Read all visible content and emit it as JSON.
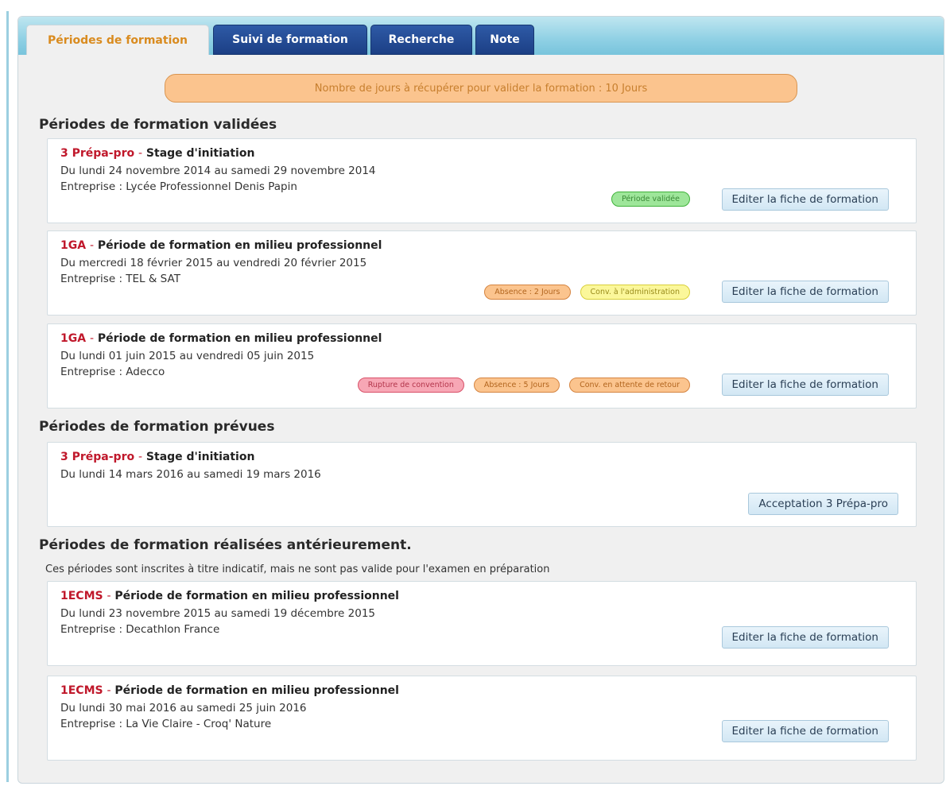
{
  "tabs": [
    {
      "label": "Périodes de formation",
      "active": true
    },
    {
      "label": "Suivi de formation",
      "active": false
    },
    {
      "label": "Recherche",
      "active": false
    },
    {
      "label": "Note",
      "active": false
    }
  ],
  "banner": "Nombre de jours à récupérer pour valider la formation : 10 Jours",
  "sections": {
    "validated": {
      "title": "Périodes de formation validées",
      "cards": [
        {
          "code": "3 Prépa-pro",
          "separator": "-",
          "title": "Stage d'initiation",
          "dates": "Du lundi 24 novembre 2014 au samedi 29 novembre 2014",
          "company": "Entreprise : Lycée Professionnel Denis Papin",
          "badges": [
            {
              "label": "Période validée",
              "color": "green"
            }
          ],
          "button": "Editer la fiche de formation"
        },
        {
          "code": "1GA",
          "separator": "-",
          "title": "Période de formation en milieu professionnel",
          "dates": "Du mercredi 18 février 2015 au vendredi 20 février 2015",
          "company": "Entreprise : TEL & SAT",
          "badges": [
            {
              "label": "Absence : 2 Jours",
              "color": "orange"
            },
            {
              "label": "Conv. à l'administration",
              "color": "yellow"
            }
          ],
          "button": "Editer la fiche de formation"
        },
        {
          "code": "1GA",
          "separator": "-",
          "title": "Période de formation en milieu professionnel",
          "dates": "Du lundi 01 juin 2015 au vendredi 05 juin 2015",
          "company": "Entreprise : Adecco",
          "badges": [
            {
              "label": "Rupture de convention",
              "color": "red"
            },
            {
              "label": "Absence : 5 Jours",
              "color": "orange"
            },
            {
              "label": "Conv. en attente de retour",
              "color": "orange"
            }
          ],
          "button": "Editer la fiche de formation"
        }
      ]
    },
    "planned": {
      "title": "Périodes de formation prévues",
      "cards": [
        {
          "code": "3 Prépa-pro",
          "separator": "-",
          "title": "Stage d'initiation",
          "dates": "Du lundi 14 mars 2016 au samedi 19 mars 2016",
          "button": "Acceptation 3 Prépa-pro"
        }
      ]
    },
    "previous": {
      "title": "Périodes de formation réalisées antérieurement.",
      "note": "Ces périodes sont inscrites à titre indicatif, mais ne sont pas valide pour l'examen en préparation",
      "cards": [
        {
          "code": "1ECMS",
          "separator": "-",
          "title": "Période de formation en milieu professionnel",
          "dates": "Du lundi 23 novembre 2015 au samedi 19 décembre 2015",
          "company": "Entreprise : Decathlon France",
          "button": "Editer la fiche de formation"
        },
        {
          "code": "1ECMS",
          "separator": "-",
          "title": "Période de formation en milieu professionnel",
          "dates": "Du lundi 30 mai 2016 au samedi 25 juin 2016",
          "company": "Entreprise : La Vie Claire - Croq' Nature",
          "button": "Editer la fiche de formation"
        }
      ]
    }
  },
  "colors": {
    "accent_tab_text": "#d98b1f",
    "tab_bg": "#1c3f85",
    "code_red": "#c0182b",
    "banner_bg": "#fbc48e"
  }
}
